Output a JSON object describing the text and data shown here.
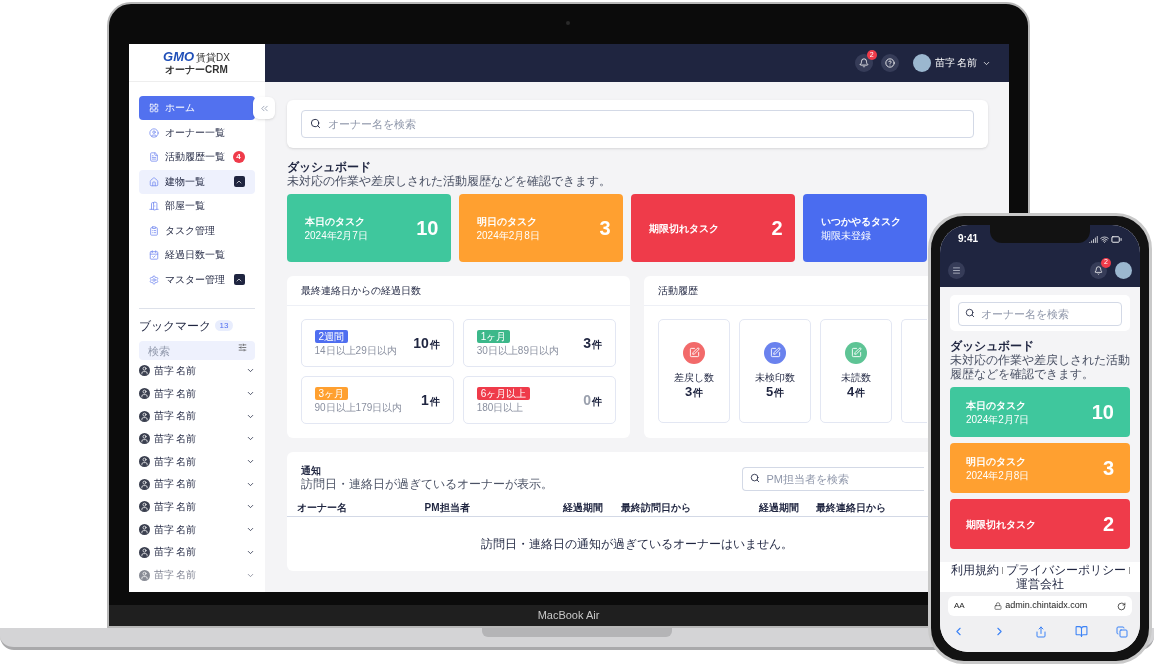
{
  "laptop": {
    "model": "MacBook Air"
  },
  "logo": {
    "brand": "GMO",
    "product": "賃貸DX",
    "subtitle": "オーナーCRM"
  },
  "sidebar": {
    "items": [
      {
        "label": "ホーム",
        "selected": true,
        "highlighted": false
      },
      {
        "label": "オーナー一覧",
        "selected": false,
        "highlighted": false
      },
      {
        "label": "活動履歴一覧",
        "selected": false,
        "highlighted": false,
        "badge": "4"
      },
      {
        "label": "建物一覧",
        "selected": false,
        "highlighted": true,
        "expanded": true
      },
      {
        "label": "部屋一覧",
        "selected": false,
        "highlighted": false
      },
      {
        "label": "タスク管理",
        "selected": false,
        "highlighted": false
      },
      {
        "label": "経過日数一覧",
        "selected": false,
        "highlighted": false
      },
      {
        "label": "マスター管理",
        "selected": false,
        "highlighted": false,
        "expanded": true
      }
    ]
  },
  "bookmarks": {
    "title": "ブックマーク",
    "count": "13",
    "search_placeholder": "検索",
    "items": [
      {
        "name": "苗字 名前",
        "faded": false
      },
      {
        "name": "苗字 名前",
        "faded": false
      },
      {
        "name": "苗字 名前",
        "faded": false
      },
      {
        "name": "苗字 名前",
        "faded": false
      },
      {
        "name": "苗字 名前",
        "faded": false
      },
      {
        "name": "苗字 名前",
        "faded": false
      },
      {
        "name": "苗字 名前",
        "faded": false
      },
      {
        "name": "苗字 名前",
        "faded": false
      },
      {
        "name": "苗字 名前",
        "faded": false
      },
      {
        "name": "苗字 名前",
        "faded": true
      }
    ]
  },
  "header": {
    "notification_count": "2",
    "user_name": "苗字 名前"
  },
  "search": {
    "placeholder": "オーナー名を検索"
  },
  "dashboard": {
    "title": "ダッシュボード",
    "subtitle": "未対応の作業や差戻しされた活動履歴などを確認できます。"
  },
  "task_cards": [
    {
      "title": "本日のタスク",
      "date": "2024年2月7日",
      "count": "10",
      "color": "#3fc79d"
    },
    {
      "title": "明日のタスク",
      "date": "2024年2月8日",
      "count": "3",
      "color": "#ffa030"
    },
    {
      "title": "期限切れタスク",
      "count": "2",
      "color": "#ef3b4a"
    },
    {
      "title": "いつかやるタスク",
      "date": "期限未登録",
      "color": "#4a6cf0"
    }
  ],
  "elapsed": {
    "title": "最終連絡日からの経過日数",
    "items": [
      {
        "tag": "2週間",
        "color": "#4f6ef0",
        "range": "14日以上29日以内",
        "count": "10",
        "unit": "件",
        "empty": false
      },
      {
        "tag": "1ヶ月",
        "color": "#3cb88a",
        "range": "30日以上89日以内",
        "count": "3",
        "unit": "件",
        "empty": false
      },
      {
        "tag": "3ヶ月",
        "color": "#ffa030",
        "range": "90日以上179日以内",
        "count": "1",
        "unit": "件",
        "empty": false
      },
      {
        "tag": "6ヶ月以上",
        "color": "#ef3b4a",
        "range": "180日以上",
        "count": "0",
        "unit": "件",
        "empty": true
      }
    ]
  },
  "activity": {
    "title": "活動履歴",
    "overflow": true,
    "items": [
      {
        "label": "差戻し数",
        "count": "3",
        "unit": "件",
        "color": "#f26a6a"
      },
      {
        "label": "未検印数",
        "count": "5",
        "unit": "件",
        "color": "#6a82ee"
      },
      {
        "label": "未読数",
        "count": "4",
        "unit": "件",
        "color": "#5ec495"
      }
    ]
  },
  "notifications": {
    "title": "通知",
    "subtitle": "訪問日・連絡日が過ぎているオーナーが表示。",
    "search_placeholder": "PM担当者を検索",
    "columns": [
      "オーナー名",
      "PM担当者",
      "経過期間",
      "最終訪問日から",
      "経過期間",
      "最終連絡日から"
    ],
    "empty_message": "訪問日・連絡日の通知が過ぎているオーナーはいません。"
  },
  "phone": {
    "time": "9:41",
    "notification_count": "2",
    "search_placeholder": "オーナー名を検索",
    "dashboard": {
      "title": "ダッシュボード",
      "subtitle": "未対応の作業や差戻しされた活動履歴などを確認できます。"
    },
    "task_cards": [
      {
        "title": "本日のタスク",
        "date": "2024年2月7日",
        "count": "10",
        "color": "#3fc79d"
      },
      {
        "title": "明日のタスク",
        "date": "2024年2月8日",
        "count": "3",
        "color": "#ffa030"
      },
      {
        "title": "期限切れタスク",
        "count": "2",
        "color": "#ef3b4a"
      }
    ],
    "footer_links": [
      "利用規約",
      "プライバシーポリシー",
      "運営会社"
    ],
    "text_size_label": "AA",
    "url": "admin.chintaidx.com"
  }
}
